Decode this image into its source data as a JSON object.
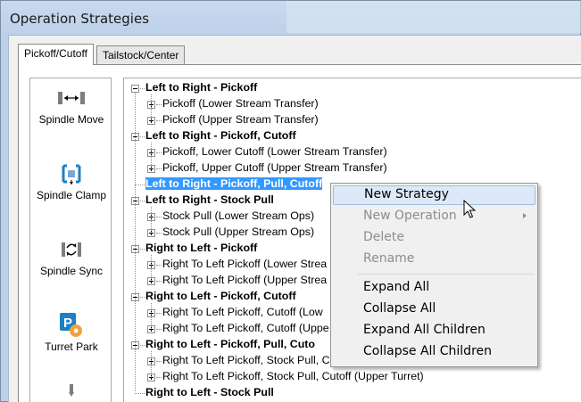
{
  "window": {
    "title": "Operation Strategies"
  },
  "tabs": [
    {
      "label": "Pickoff/Cutoff",
      "active": true
    },
    {
      "label": "Tailstock/Center",
      "active": false
    }
  ],
  "toolbar": {
    "items": [
      {
        "label": "Spindle Move",
        "icon": "spindle-move-icon"
      },
      {
        "label": "Spindle Clamp",
        "icon": "spindle-clamp-icon"
      },
      {
        "label": "Spindle Sync",
        "icon": "spindle-sync-icon"
      },
      {
        "label": "Turret Park",
        "icon": "turret-park-icon"
      }
    ]
  },
  "tree": {
    "groups": [
      {
        "label": "Left to Right - Pickoff",
        "children": [
          "Pickoff (Lower Stream Transfer)",
          "Pickoff (Upper Stream Transfer)"
        ]
      },
      {
        "label": "Left to Right - Pickoff, Cutoff",
        "children": [
          "Pickoff, Lower Cutoff (Lower Stream Transfer)",
          "Pickoff, Upper Cutoff (Upper Stream Transfer)"
        ]
      },
      {
        "label": "Left to Right - Pickoff, Pull, Cutoff",
        "children": [],
        "selected": true
      },
      {
        "label": "Left to Right - Stock Pull",
        "children": [
          "Stock Pull (Lower Stream Ops)",
          "Stock Pull (Upper Stream Ops)"
        ]
      },
      {
        "label": "Right to Left - Pickoff",
        "children": [
          "Right To Left Pickoff (Lower Strea",
          "Right To Left Pickoff (Upper Strea"
        ]
      },
      {
        "label": "Right to Left - Pickoff, Cutoff",
        "children": [
          "Right To Left Pickoff, Cutoff (Low",
          "Right To Left Pickoff, Cutoff (Uppe"
        ]
      },
      {
        "label": "Right to Left - Pickoff, Pull, Cuto",
        "children": [
          "Right To Left Pickoff, Stock Pull, C",
          "Right To Left Pickoff, Stock Pull, Cutoff (Upper Turret)"
        ]
      },
      {
        "label": "Right to Left - Stock Pull",
        "children": []
      }
    ]
  },
  "context_menu": {
    "items": [
      {
        "label": "New Strategy",
        "enabled": true,
        "hover": true
      },
      {
        "label": "New Operation",
        "enabled": false,
        "submenu": true
      },
      {
        "label": "Delete",
        "enabled": false
      },
      {
        "label": "Rename",
        "enabled": false
      },
      {
        "label": "Expand All",
        "enabled": true
      },
      {
        "label": "Collapse All",
        "enabled": true
      },
      {
        "label": "Expand All Children",
        "enabled": true
      },
      {
        "label": "Collapse All Children",
        "enabled": true
      }
    ]
  },
  "colors": {
    "selection": "#3399ff",
    "menu_hover": "#dde9f8",
    "disabled_text": "#8d8d8d"
  }
}
